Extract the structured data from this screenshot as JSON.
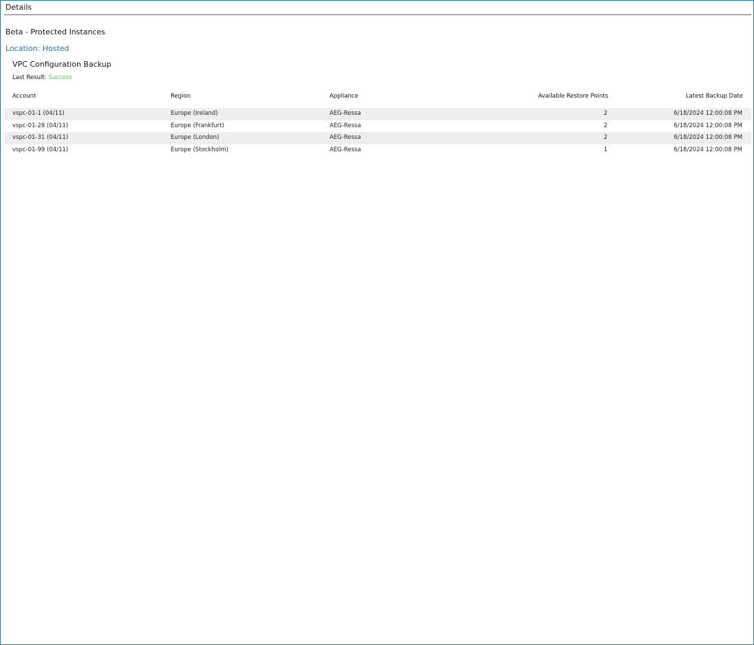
{
  "panel": {
    "title": "Details"
  },
  "report": {
    "title": "Beta - Protected Instances",
    "location": "Location: Hosted",
    "section_title": "VPC Configuration Backup",
    "last_result_label": "Last Result:",
    "last_result_value": "Success"
  },
  "colors": {
    "accent": "#1f7a9c",
    "location_text": "#2e6fa3",
    "success": "#5cb85c",
    "row_alt": "#eeeeee"
  },
  "table": {
    "headers": [
      "Account",
      "Region",
      "Appliance",
      "Available Restore Points",
      "Latest Backup Date"
    ],
    "rows": [
      [
        "vspc-01-1 (04/11)",
        "Europe (Ireland)",
        "AEG-Ressa",
        "2",
        "6/18/2024 12:00:08 PM"
      ],
      [
        "vspc-01-28 (04/11)",
        "Europe (Frankfurt)",
        "AEG-Ressa",
        "2",
        "6/18/2024 12:00:08 PM"
      ],
      [
        "vspc-01-31 (04/11)",
        "Europe (London)",
        "AEG-Ressa",
        "2",
        "6/18/2024 12:00:08 PM"
      ],
      [
        "vspc-01-99 (04/11)",
        "Europe (Stockholm)",
        "AEG-Ressa",
        "1",
        "6/18/2024 12:00:08 PM"
      ]
    ]
  }
}
